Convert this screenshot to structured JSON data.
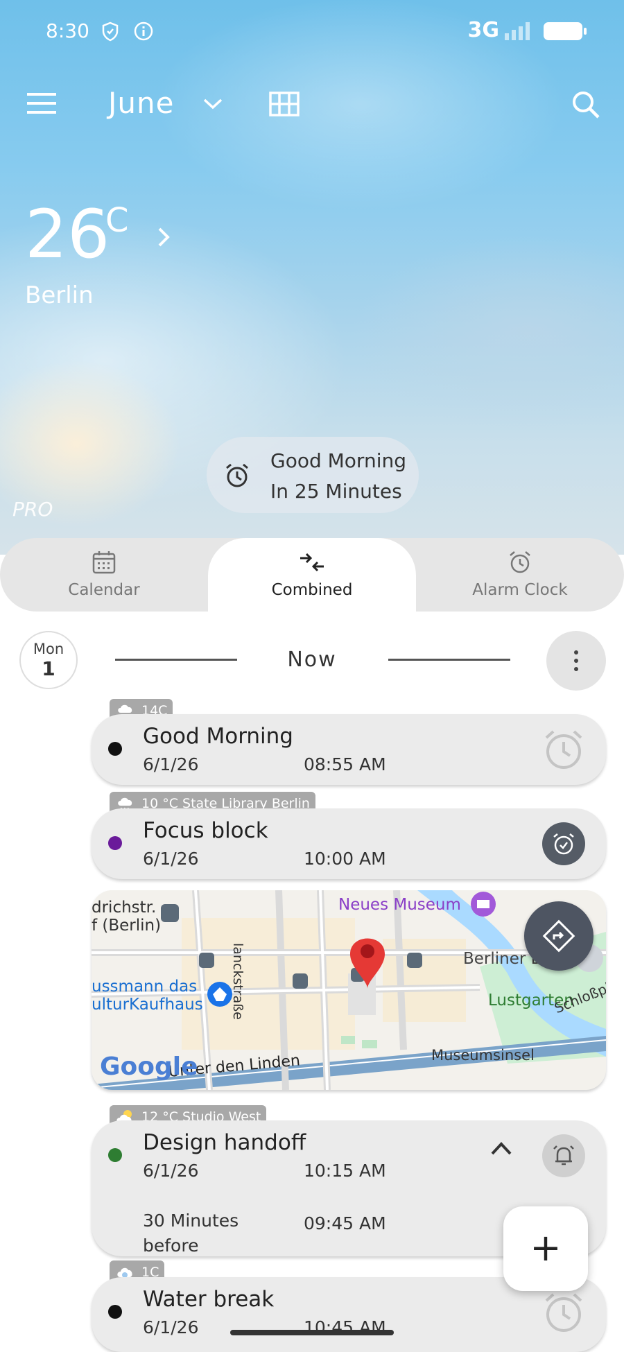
{
  "status_bar": {
    "time": "8:30",
    "network": "3G"
  },
  "toolbar": {
    "month": "June"
  },
  "weather": {
    "temperature": "26",
    "unit": "C",
    "city": "Berlin",
    "badge": "PRO"
  },
  "next_alarm": {
    "title": "Good Morning",
    "subtitle": "In 25 Minutes"
  },
  "tabs": [
    {
      "label": "Calendar",
      "icon": "calendar-icon"
    },
    {
      "label": "Combined",
      "icon": "combine-arrows-icon"
    },
    {
      "label": "Alarm Clock",
      "icon": "alarm-clock-icon"
    }
  ],
  "day": {
    "dow": "Mon",
    "num": "1",
    "now_label": "Now"
  },
  "events": [
    {
      "title": "Good Morning",
      "date": "6/1/26",
      "time": "08:55 AM",
      "weather": "14C",
      "weather_icon": "rain-cloud-icon",
      "dot_color": "#111111",
      "action_icon": "alarm-icon"
    },
    {
      "title": "Focus block",
      "date": "6/1/26",
      "time": "10:00 AM",
      "weather": "10 °C State Library Berlin",
      "weather_icon": "rain-cloud-icon",
      "dot_color": "#6a1b9a",
      "action_icon": "alarm-check-icon"
    },
    {
      "title": "Design handoff",
      "date": "6/1/26",
      "time": "10:15 AM",
      "weather": "12 °C Studio West",
      "weather_icon": "sun-cloud-icon",
      "dot_color": "#2e7d32",
      "reminder_label": "30 Minutes",
      "reminder_label2": "before",
      "reminder_time": "09:45 AM",
      "action_icon": "bell-alarm-icon"
    },
    {
      "title": "Water break",
      "date": "6/1/26",
      "time": "10:45 AM",
      "weather": "1C",
      "weather_icon": "cloud-icon",
      "dot_color": "#111111",
      "action_icon": "alarm-icon"
    }
  ],
  "map": {
    "labels": {
      "neues_museum": "Neues Museum",
      "friedrichstr": "drichstr.",
      "berlin": "f (Berlin)",
      "dussmann1": "ussmann das",
      "dussmann2": "ulturKaufhaus",
      "planckstr": "lanckstraße",
      "berliner": "Berliner D",
      "lustgarten": "Lustgarten",
      "schloss": "Schloßpl",
      "museumsinsel": "Museumsinsel",
      "linden": "Unter den Linden",
      "google": "Google"
    }
  },
  "fab": {
    "label": "+"
  }
}
